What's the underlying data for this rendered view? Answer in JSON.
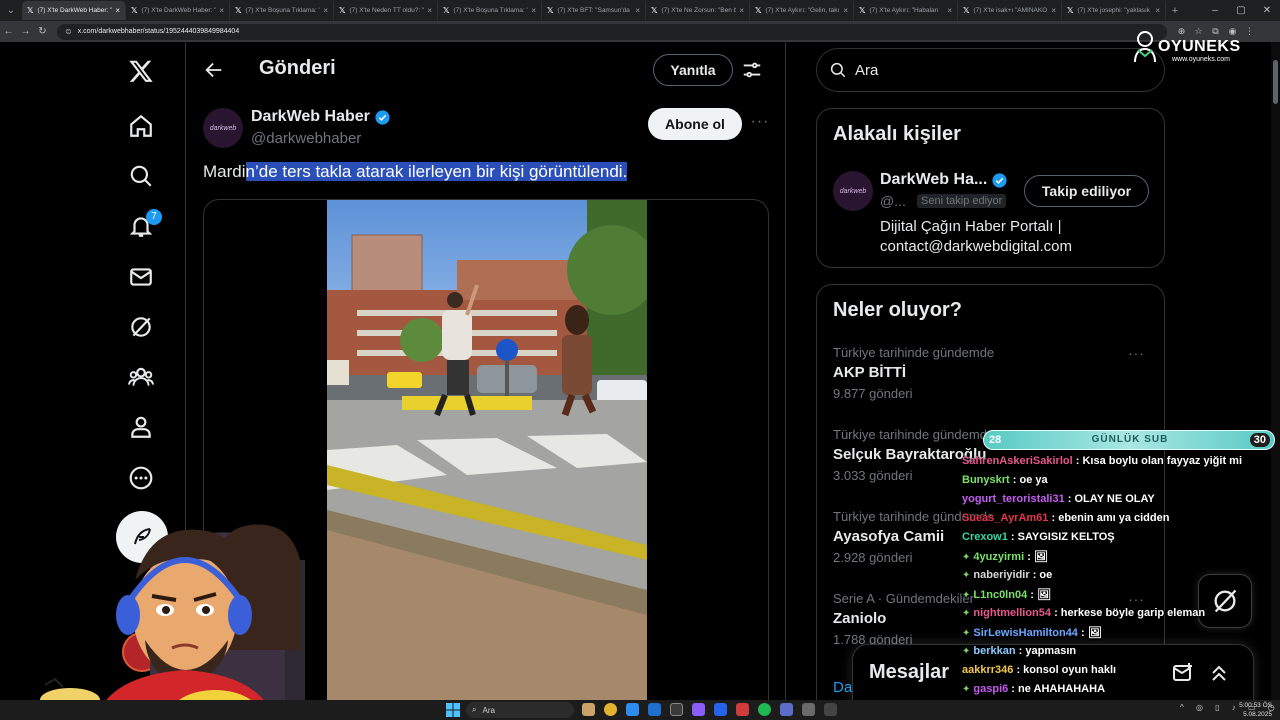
{
  "browser": {
    "tabs": [
      {
        "title": "(7) X'te DarkWeb Haber: \"",
        "active": true
      },
      {
        "title": "(7) X'te DarkWeb Haber: \"",
        "active": false
      },
      {
        "title": "(7) X'te Boşuna Tıklama: \"",
        "active": false
      },
      {
        "title": "(7) X'te Neden TT oldu?: \"",
        "active": false
      },
      {
        "title": "(7) X'te Boşuna Tıklama: \"",
        "active": false
      },
      {
        "title": "(7) X'te BFT: \"Samsun'da \"",
        "active": false
      },
      {
        "title": "(7) X'te Ne Zorsun: \"Ben b",
        "active": false
      },
      {
        "title": "(7) X'te Aykırı: \"Gelin, takı",
        "active": false
      },
      {
        "title": "(7) X'te Aykırı: \"Habaları",
        "active": false
      },
      {
        "title": "(7) X'te isak+ı \"AMINAKO",
        "active": false
      },
      {
        "title": "(7) X'te josephi: \"yaklasık",
        "active": false
      }
    ],
    "url": "x.com/darkwebhaber/status/1952444039849984404"
  },
  "nav": {
    "notifications_badge": "7"
  },
  "header": {
    "title": "Gönderi",
    "reply_label": "Yanıtla"
  },
  "tweet": {
    "author_name": "DarkWeb Haber",
    "author_handle": "@darkwebhaber",
    "avatar_text": "darkweb",
    "subscribe_label": "Abone ol",
    "text_prefix": "Mardi",
    "text_highlight": "n’de ters takla atarak ilerleyen bir kişi görüntülendi."
  },
  "search": {
    "placeholder": "Ara"
  },
  "relevant": {
    "title": "Alakalı kişiler",
    "name": "DarkWeb Ha...",
    "handle": "@...",
    "follows_you": "Seni takip ediyor",
    "following_label": "Takip ediliyor",
    "bio": "Dijital Çağın Haber Portalı | contact@darkwebdigital.com",
    "avatar_text": "darkweb"
  },
  "trends": {
    "title": "Neler oluyor?",
    "items": [
      {
        "context": "Türkiye tarihinde gündemde",
        "name": "AKP BİTTİ",
        "count": "9.877 gönderi"
      },
      {
        "context": "Türkiye tarihinde gündemde",
        "name": "Selçuk Bayraktaroğlu",
        "count": "3.033 gönderi"
      },
      {
        "context": "Türkiye tarihinde gündemde",
        "name": "Ayasofya Camii",
        "count": "2.928 gönderi"
      },
      {
        "context": "Serie A · Gündemdekiler",
        "name": "Zaniolo",
        "count": "1.788 gönderi"
      }
    ],
    "more_link": "Da"
  },
  "messages": {
    "title": "Mesajlar"
  },
  "overlay": {
    "brand_name": "OYUNEKS",
    "brand_url": "www.oyuneks.com",
    "sub_bar": {
      "left": "28",
      "label": "GÜNLÜK SUB",
      "right": "30"
    },
    "chat": [
      {
        "user": "SahrenAskeriSakirlol",
        "msg": "Kısa boylu olan fayyaz yiğit mi",
        "color": "#e8578a",
        "badge": false
      },
      {
        "user": "Bunyskrt",
        "msg": "oe ya",
        "color": "#7be06a",
        "badge": false
      },
      {
        "user": "yogurt_teroristali31",
        "msg": "OLAY NE OLAY",
        "color": "#c45cf0",
        "badge": false
      },
      {
        "user": "Sueas_AyrAm61",
        "msg": "ebenin amı ya cidden",
        "color": "#e2354b",
        "badge": false
      },
      {
        "user": "Crexow1",
        "msg": "SAYGISIZ KELTOŞ",
        "color": "#38d6a0",
        "badge": false
      },
      {
        "user": "4yuzyirmi",
        "msg": "🖼",
        "color": "#7be06a",
        "badge": true
      },
      {
        "user": "naberiyidir",
        "msg": "oe",
        "color": "#d8d8d8",
        "badge": true
      },
      {
        "user": "L1nc0ln04",
        "msg": "🖼",
        "color": "#7be06a",
        "badge": true
      },
      {
        "user": "nightmellion54",
        "msg": "herkese böyle garip eleman",
        "color": "#e8578a",
        "badge": true
      },
      {
        "user": "SirLewisHamilton44",
        "msg": "🖼",
        "color": "#6aa8ff",
        "badge": true
      },
      {
        "user": "berkkan",
        "msg": "yapmasın",
        "color": "#8ec9ff",
        "badge": true
      },
      {
        "user": "aakkrr346",
        "msg": "konsol oyun haklı",
        "color": "#f2c94c",
        "badge": false
      },
      {
        "user": "gaspi6",
        "msg": "ne AHAHAHAHA",
        "color": "#c45cf0",
        "badge": true
      }
    ]
  },
  "taskbar": {
    "search_placeholder": "Ara",
    "time": "5:00:53 ÖS",
    "date": "5.08.2025"
  },
  "colors": {
    "accent": "#1d9bf0",
    "selection": "#2b4fb8",
    "sub_bar": "#58c9c4"
  }
}
